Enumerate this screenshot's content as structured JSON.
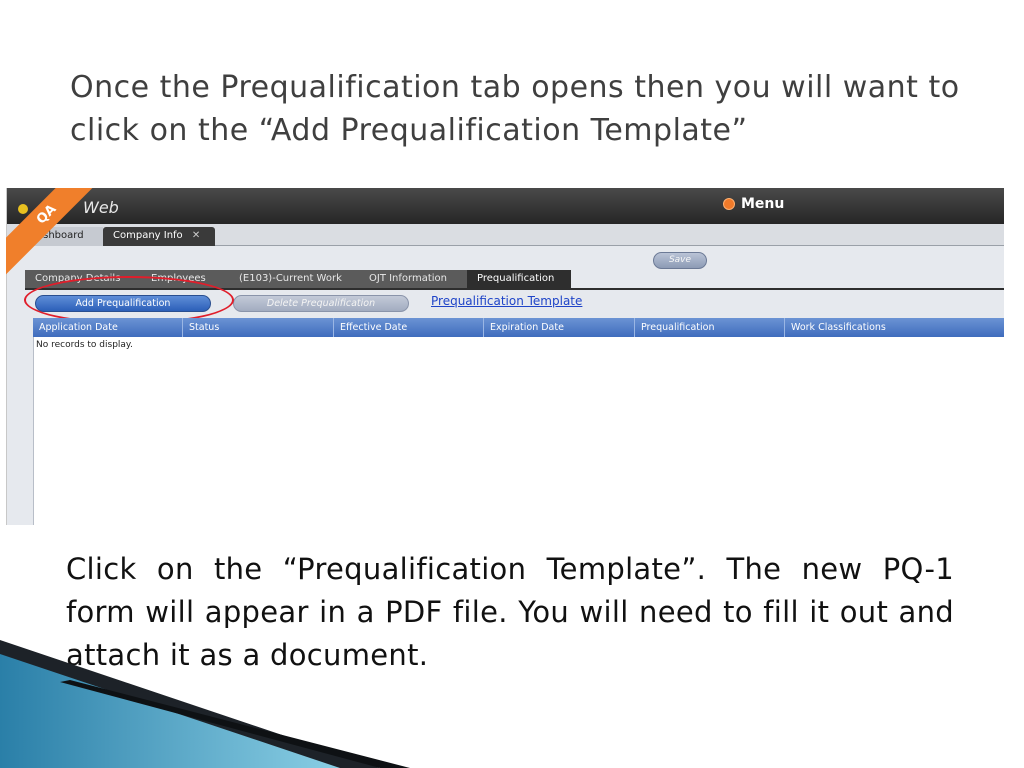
{
  "slide": {
    "title": "Once the Prequalification tab opens then you will want to click on the “Add Prequalification Template”",
    "body": "Click on the “Prequalification Template”.  The new PQ-1 form will appear in a PDF file.  You will need to fill it out and attach it as a document."
  },
  "app": {
    "logo_text": "Web",
    "qa_badge": "QA",
    "menu_label": "Menu",
    "doc_tabs": [
      {
        "label": "ashboard"
      },
      {
        "label": "Company Info",
        "close": "✕"
      }
    ],
    "save_label": "Save",
    "sub_tabs": [
      {
        "label": "Company Details"
      },
      {
        "label": "Employees"
      },
      {
        "label": "(E103)-Current Work"
      },
      {
        "label": "OJT Information"
      },
      {
        "label": "Prequalification"
      }
    ],
    "toolbar": {
      "add_label": "Add Prequalification",
      "delete_label": "Delete Prequalification",
      "template_link": "Prequalification Template"
    },
    "grid": {
      "columns": [
        "Application Date",
        "Status",
        "Effective Date",
        "Expiration Date",
        "Prequalification",
        "Work Classifications"
      ],
      "empty_text": "No records to display."
    }
  },
  "colors": {
    "accent": "#3f6cbd",
    "highlight_ring": "#e01e2b",
    "qa_ribbon": "#f07f2b"
  }
}
